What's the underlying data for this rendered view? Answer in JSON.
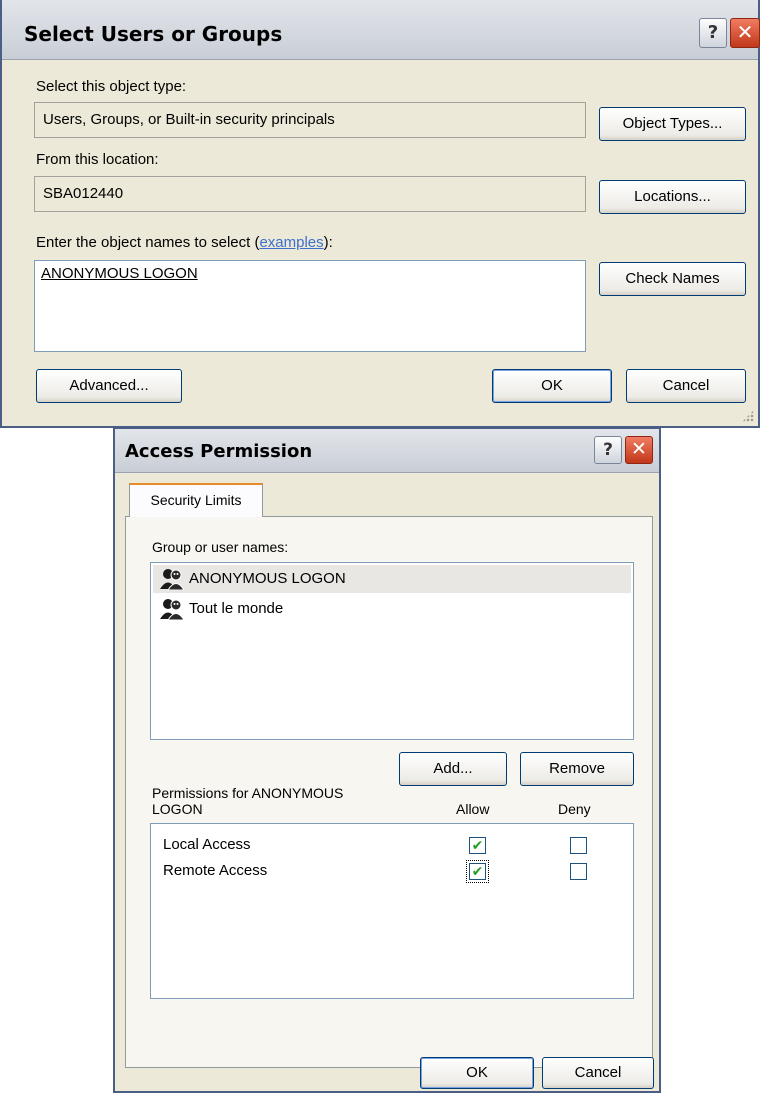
{
  "select_dialog": {
    "title": "Select Users or Groups",
    "help_glyph": "?",
    "close_glyph": "✕",
    "object_type_label": "Select this object type:",
    "object_type_value": "Users, Groups, or Built-in security principals",
    "object_types_button": "Object Types...",
    "location_label": "From this location:",
    "location_value": "SBA012440",
    "locations_button": "Locations...",
    "enter_names_label": "Enter the object names to select (",
    "examples_link": "examples",
    "enter_names_suffix": "):",
    "names_value": "ANONYMOUS LOGON",
    "check_names_button": "Check Names",
    "advanced_button": "Advanced...",
    "ok_button": "OK",
    "cancel_button": "Cancel"
  },
  "access_dialog": {
    "title": "Access Permission",
    "help_glyph": "?",
    "close_glyph": "✕",
    "tab_label": "Security Limits",
    "group_names_label": "Group or user names:",
    "users": [
      {
        "name": "ANONYMOUS LOGON",
        "selected": true,
        "icon": "user-group-icon"
      },
      {
        "name": "Tout le monde",
        "selected": false,
        "icon": "user-group-icon"
      }
    ],
    "add_button": "Add...",
    "remove_button": "Remove",
    "permissions_label_line1": "Permissions for ANONYMOUS",
    "permissions_label_line2": "LOGON",
    "allow_header": "Allow",
    "deny_header": "Deny",
    "permissions": [
      {
        "name": "Local Access",
        "allow": true,
        "deny": false
      },
      {
        "name": "Remote Access",
        "allow": true,
        "deny": false
      }
    ],
    "check_glyph": "✔",
    "ok_button": "OK",
    "cancel_button": "Cancel"
  },
  "colors": {
    "dialog_bg": "#ece9d8",
    "title_gradient_top": "#e2e5ea",
    "close_red": "#c1371a",
    "link_blue": "#3d6fcf",
    "check_green": "#21a121",
    "button_border": "#003c74"
  }
}
